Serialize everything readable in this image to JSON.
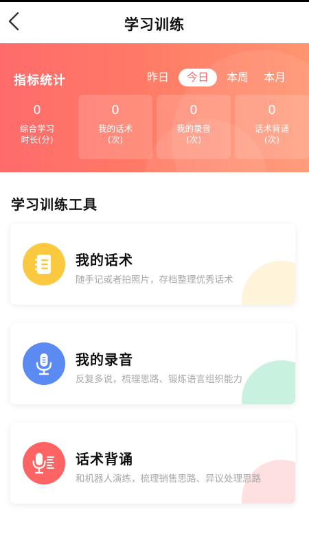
{
  "header": {
    "title": "学习训练",
    "back_icon": "chevron-left-icon"
  },
  "stats": {
    "title": "指标统计",
    "periods": [
      "昨日",
      "今日",
      "本周",
      "本月"
    ],
    "active_period": "今日",
    "items": [
      {
        "value": "0",
        "label_line1": "综合学习",
        "label_line2": "时长(分)"
      },
      {
        "value": "0",
        "label_line1": "我的话术",
        "label_line2": "(次)"
      },
      {
        "value": "0",
        "label_line1": "我的录音",
        "label_line2": "(次)"
      },
      {
        "value": "0",
        "label_line1": "话术背诵",
        "label_line2": "(次)"
      }
    ],
    "colors": {
      "gradient_start": "#ff6b6b",
      "gradient_end": "#ff9470"
    }
  },
  "tools": {
    "section_title": "学习训练工具",
    "items": [
      {
        "name": "我的话术",
        "desc": "随手记或者拍照片，存档整理优秀话术",
        "icon": "notebook-icon",
        "color": "#fbc93f",
        "deco_color": "#fff3d9"
      },
      {
        "name": "我的录音",
        "desc": "反复多说，梳理思路、锻炼语言组织能力",
        "icon": "microphone-icon",
        "color": "#5b8bf2",
        "deco_color": "#c9f1df"
      },
      {
        "name": "话术背诵",
        "desc": "和机器人演练，梳理销售思路、异议处理思路",
        "icon": "voice-record-icon",
        "color": "#ff6464",
        "deco_color": "#ffe0e0"
      }
    ]
  }
}
